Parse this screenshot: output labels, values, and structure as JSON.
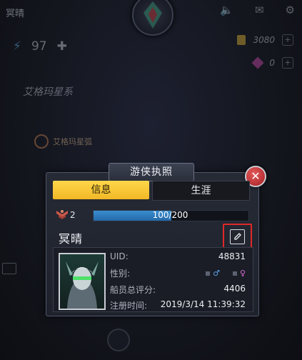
{
  "hud": {
    "player_name": "冥晴",
    "level": "97",
    "coins": "3080",
    "gems": "0",
    "system_name": "艾格玛星系",
    "arc_name": "艾格玛星弧"
  },
  "dialog": {
    "title": "游侠执照",
    "close_symbol": "✕",
    "tabs": [
      {
        "label": "信息",
        "active": true
      },
      {
        "label": "生涯",
        "active": false
      }
    ],
    "rank": "2",
    "xp_text": "100/200",
    "xp_fraction": 0.5,
    "pilot_name": "冥晴",
    "info": {
      "uid_label": "UID:",
      "uid_value": "48831",
      "gender_label": "性别:",
      "male_symbol": "♂",
      "female_symbol": "♀",
      "score_label": "船员总评分:",
      "score_value": "4406",
      "reg_label": "注册时间:",
      "reg_value": "2019/3/14 11:39:32"
    }
  },
  "colors": {
    "tab_active": "#f5c12e",
    "xp_fill": "#2f7bc0",
    "close_btn": "#c8302f",
    "edit_highlight": "#e02828"
  }
}
